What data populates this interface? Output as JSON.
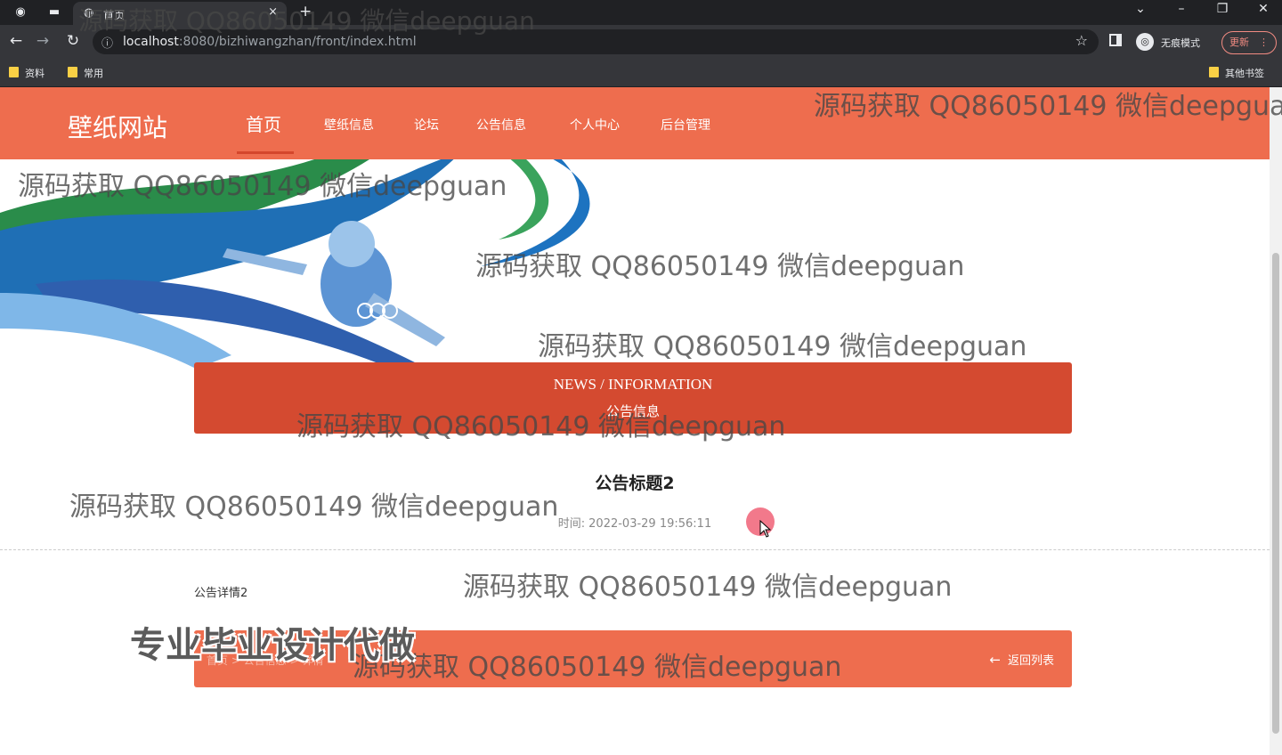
{
  "browser": {
    "tab": {
      "title": "首页",
      "close": "×"
    },
    "new_tab": "+",
    "window_controls": {
      "dropdown": "⌄",
      "minimize": "–",
      "restore": "❐",
      "close": "✕"
    },
    "url": {
      "host": "localhost",
      "rest": ":8080/bizhiwangzhan/front/index.html"
    },
    "incognito_label": "无痕模式",
    "update_label": "更新",
    "bookmarks": [
      "资料",
      "常用"
    ],
    "other_bookmarks": "其他书签"
  },
  "site": {
    "brand": "壁纸网站",
    "nav": [
      "首页",
      "壁纸信息",
      "论坛",
      "公告信息",
      "个人中心",
      "后台管理"
    ],
    "accent": "#ee6d4e",
    "accent_dark": "#d44a30"
  },
  "news_header": {
    "en": "NEWS / INFORMATION",
    "zh": "公告信息"
  },
  "article": {
    "title": "公告标题2",
    "time_label": "时间:",
    "time_value": "2022-03-29 19:56:11",
    "body": "公告详情2"
  },
  "footer_bar": {
    "crumb": "首页 > 公告信息 > 详情",
    "back_label": "返回列表"
  },
  "watermark": "源码获取 QQ86050149 微信deepguan",
  "promo": "专业毕业设计代做"
}
